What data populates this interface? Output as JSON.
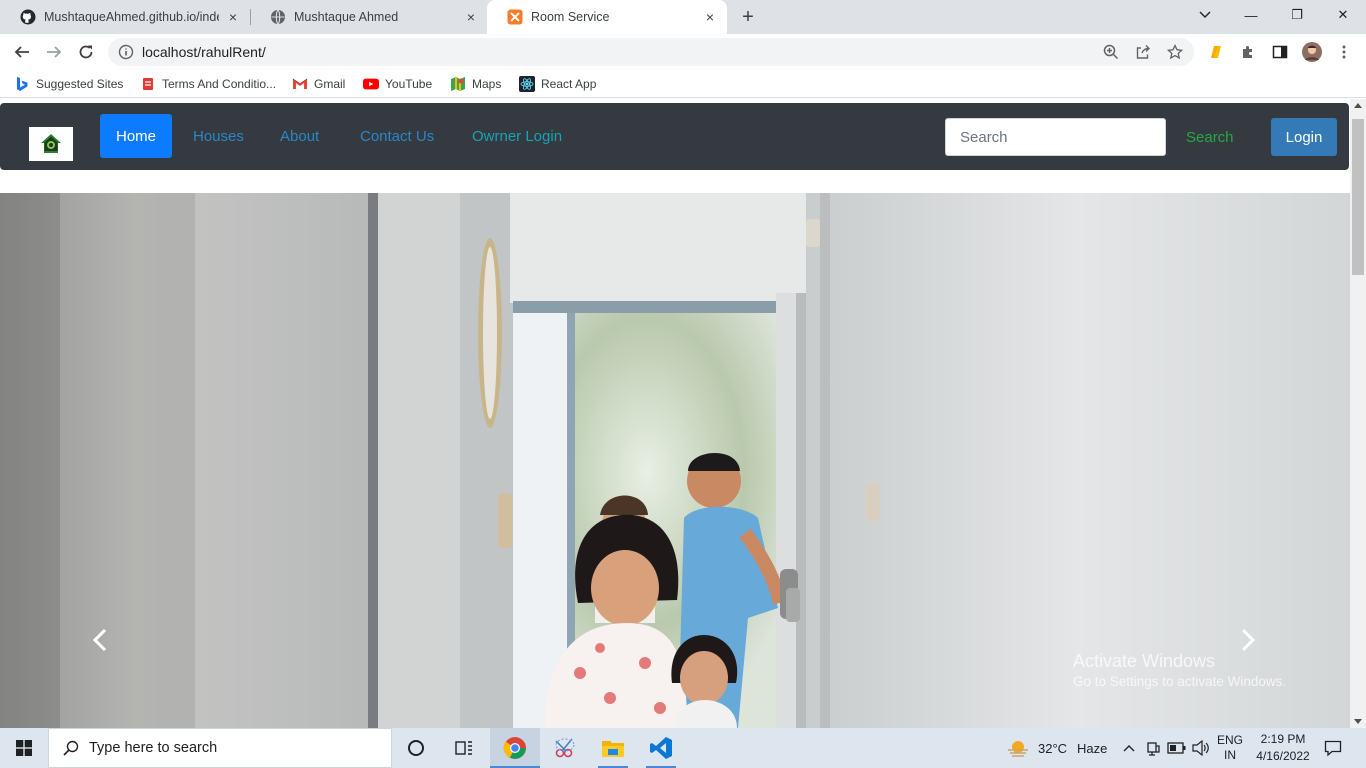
{
  "browser": {
    "tabs": [
      {
        "title": "MushtaqueAhmed.github.io/inde",
        "icon": "github-icon",
        "close": "×"
      },
      {
        "title": "Mushtaque Ahmed",
        "icon": "globe-icon",
        "close": "×"
      },
      {
        "title": "Room Service",
        "icon": "xampp-icon",
        "close": "×",
        "active": true
      }
    ],
    "new_tab": "+",
    "window_controls": {
      "minimize": "—",
      "restore": "❐",
      "close": "✕"
    },
    "url": "localhost/rahulRent/",
    "bookmarks": [
      {
        "label": "Suggested Sites",
        "icon": "bing-icon"
      },
      {
        "label": "Terms And Conditio...",
        "icon": "page-icon"
      },
      {
        "label": "Gmail",
        "icon": "gmail-icon"
      },
      {
        "label": "YouTube",
        "icon": "youtube-icon"
      },
      {
        "label": "Maps",
        "icon": "maps-icon"
      },
      {
        "label": "React App",
        "icon": "react-icon"
      }
    ]
  },
  "site": {
    "nav": {
      "home": "Home",
      "houses": "Houses",
      "about": "About",
      "contact": "Contact Us",
      "owner_login": "Owrner Login"
    },
    "search_placeholder": "Search",
    "search_button": "Search",
    "login_button": "Login"
  },
  "watermark": {
    "line1": "Activate Windows",
    "line2": "Go to Settings to activate Windows."
  },
  "taskbar": {
    "search_placeholder": "Type here to search",
    "weather": {
      "temp": "32°C",
      "condition": "Haze"
    },
    "lang": {
      "line1": "ENG",
      "line2": "IN"
    },
    "clock": {
      "time": "2:19 PM",
      "date": "4/16/2022"
    }
  },
  "colors": {
    "navbar_bg": "#343a40",
    "active_link": "#0d7bff",
    "link": "#2a85c9",
    "teal_link": "#17a2b8",
    "search_button": "#28a745",
    "login_button": "#337ab7"
  }
}
